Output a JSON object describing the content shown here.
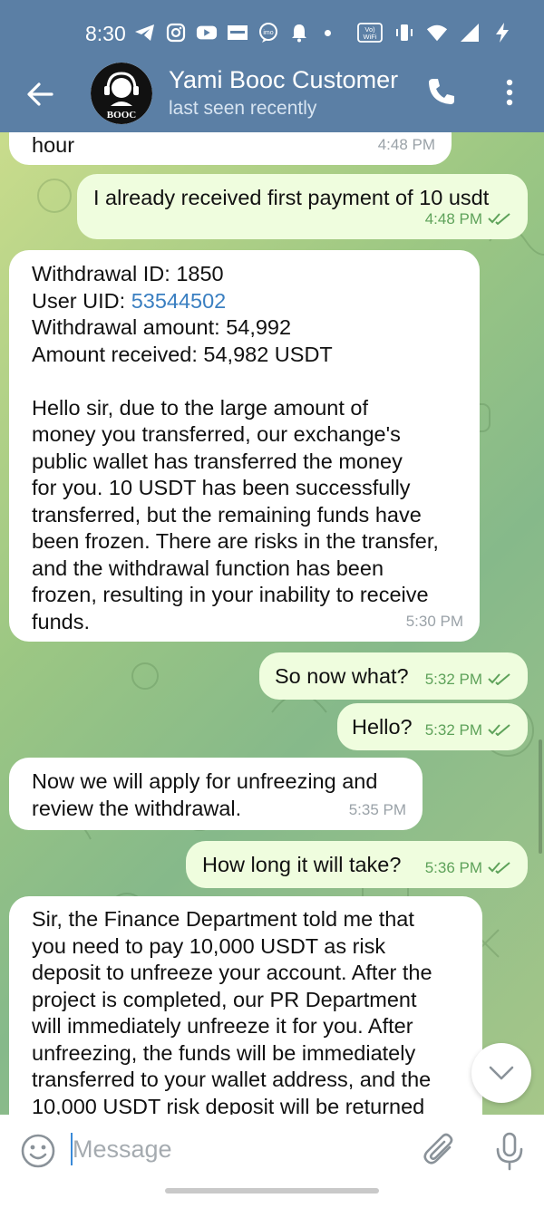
{
  "status_bar": {
    "time": "8:30",
    "left_icons": [
      "telegram-icon",
      "instagram-icon",
      "youtube-icon",
      "news-icon",
      "imo-icon",
      "bell-icon",
      "dot-icon"
    ],
    "right_icons": [
      "vowifi-icon",
      "vibrate-icon",
      "wifi-icon",
      "signal-icon",
      "charging-icon"
    ],
    "vowifi_label": "Vo)\nWiFi"
  },
  "header": {
    "title": "Yami Booc Customer",
    "subtitle": "last seen recently",
    "avatar_text": "BOOC",
    "colors": {
      "bar": "#5b7fa5",
      "subtitle": "#d7e4f1"
    }
  },
  "messages": [
    {
      "dir": "in",
      "text": "hour",
      "time": "4:48 PM"
    },
    {
      "dir": "out",
      "text": "I already received first payment of 10 usdt",
      "time": "4:48 PM",
      "read": true
    },
    {
      "dir": "in",
      "lines": {
        "l1": "Withdrawal ID: 1850",
        "l2_prefix": "User UID: ",
        "l2_link": "53544502",
        "l3": "Withdrawal amount: 54,992",
        "l4": "Amount received: 54,982 USDT",
        "body": "Hello sir, due to the large amount of\nmoney you transferred, our exchange's\npublic wallet has transferred the money\nfor you. 10 USDT has been successfully\ntransferred, but the remaining funds have\nbeen frozen. There are risks in the transfer,\nand the withdrawal function has been\nfrozen, resulting in your inability to receive\nfunds."
      },
      "time": "5:30 PM"
    },
    {
      "dir": "out",
      "text": "So now what?",
      "time": "5:32 PM",
      "read": true
    },
    {
      "dir": "out",
      "text": "Hello?",
      "time": "5:32 PM",
      "read": true
    },
    {
      "dir": "in",
      "text": "Now we will apply for unfreezing and\nreview the withdrawal.",
      "time": "5:35 PM"
    },
    {
      "dir": "out",
      "text": "How long it will take?",
      "time": "5:36 PM",
      "read": true
    },
    {
      "dir": "in",
      "text": "Sir, the Finance Department told me that\nyou need to pay 10,000 USDT as risk\ndeposit to unfreeze your account. After the\nproject is completed, our PR Department\nwill immediately unfreeze it for you. After\nunfreezing, the funds will be immediately\ntransferred to your wallet address, and the\n10,000 USDT risk deposit will be returned"
    }
  ],
  "composer": {
    "placeholder": "Message",
    "value": ""
  },
  "colors": {
    "incoming_bubble": "#ffffff",
    "outgoing_bubble": "#effdde",
    "outgoing_meta": "#5ea25a",
    "incoming_meta": "#9aa2a8",
    "link": "#3a7fc1"
  }
}
